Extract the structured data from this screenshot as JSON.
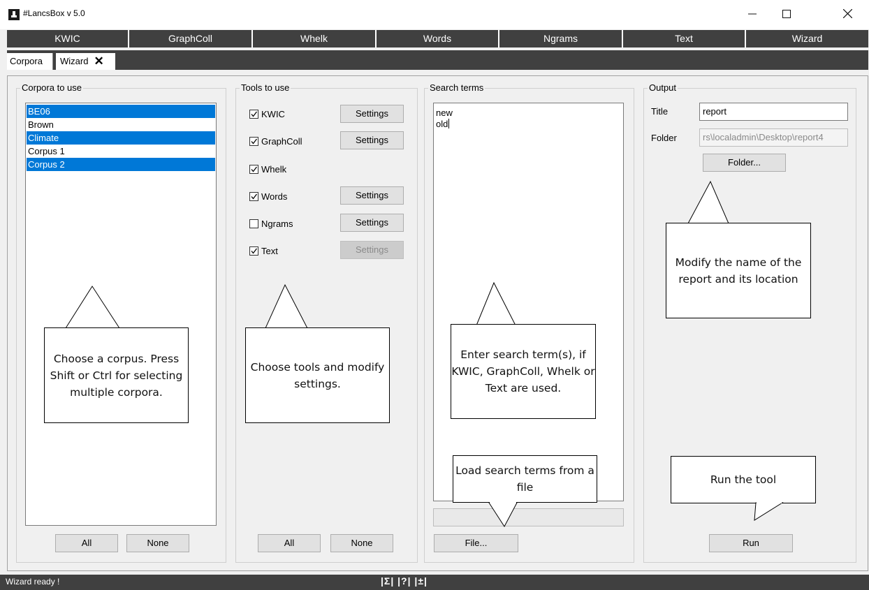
{
  "window": {
    "title": "#LancsBox v 5.0"
  },
  "tool_tabs": [
    "KWIC",
    "GraphColl",
    "Whelk",
    "Words",
    "Ngrams",
    "Text",
    "Wizard"
  ],
  "sub_tabs": {
    "corpora": "Corpora",
    "wizard": "Wizard",
    "close_symbol": "✕"
  },
  "corpora_panel": {
    "legend": "Corpora to use",
    "items": [
      {
        "label": "BE06",
        "selected": true
      },
      {
        "label": "Brown",
        "selected": false
      },
      {
        "label": "Climate",
        "selected": true
      },
      {
        "label": "Corpus 1",
        "selected": false
      },
      {
        "label": "Corpus 2",
        "selected": true
      }
    ],
    "all_label": "All",
    "none_label": "None"
  },
  "tools_panel": {
    "legend": "Tools to use",
    "tools": [
      {
        "label": "KWIC",
        "checked": true,
        "settings": "Settings",
        "settings_enabled": true
      },
      {
        "label": "GraphColl",
        "checked": true,
        "settings": "Settings",
        "settings_enabled": true
      },
      {
        "label": "Whelk",
        "checked": true,
        "settings": null,
        "settings_enabled": false
      },
      {
        "label": "Words",
        "checked": true,
        "settings": "Settings",
        "settings_enabled": true
      },
      {
        "label": "Ngrams",
        "checked": false,
        "settings": "Settings",
        "settings_enabled": true
      },
      {
        "label": "Text",
        "checked": true,
        "settings": "Settings",
        "settings_enabled": false
      }
    ],
    "all_label": "All",
    "none_label": "None"
  },
  "search_panel": {
    "legend": "Search terms",
    "lines": [
      "new",
      "old"
    ],
    "file_label": "File..."
  },
  "output_panel": {
    "legend": "Output",
    "title_label": "Title",
    "title_value": "report",
    "folder_label": "Folder",
    "folder_value": "rs\\localadmin\\Desktop\\report4",
    "folder_button": "Folder...",
    "run_label": "Run"
  },
  "callouts": {
    "corpus": "Choose a corpus. Press Shift or Ctrl for selecting multiple corpora.",
    "tools": "Choose tools and modify settings.",
    "search": "Enter search term(s), if KWIC, GraphColl, Whelk or Text are used.",
    "load": "Load search terms from a file",
    "output": "Modify the name of the report and its location",
    "run": "Run the tool"
  },
  "status": {
    "text": "Wizard ready !",
    "icons": "|Σ| |?| |±|"
  },
  "colors": {
    "selection": "#0078d7",
    "dark_bar": "#404040"
  }
}
